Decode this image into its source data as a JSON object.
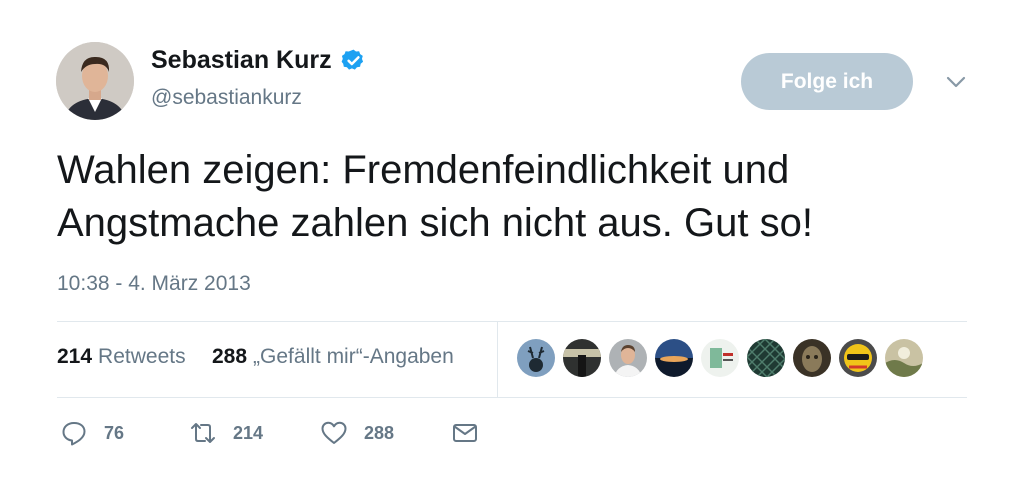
{
  "author": {
    "display_name": "Sebastian Kurz",
    "handle": "@sebastiankurz",
    "verified": true
  },
  "follow_button": {
    "label": "Folge ich"
  },
  "tweet": {
    "text": "Wahlen zeigen: Fremdenfeindlichkeit und Angstmache zahlen sich nicht aus. Gut so!",
    "timestamp": "10:38 - 4. März 2013"
  },
  "stats": {
    "retweets_count": "214",
    "retweets_label": "Retweets",
    "likes_count": "288",
    "likes_label": "„Gefällt mir“-Angaben"
  },
  "liker_avatars": [
    "deer-photo",
    "person-photo",
    "man-portrait",
    "sunset-photo",
    "logo-image",
    "net-pattern",
    "statue-photo",
    "helmet-photo",
    "pattern-photo"
  ],
  "actions": {
    "reply_count": "76",
    "retweet_count": "214",
    "like_count": "288"
  },
  "colors": {
    "verified": "#1da1f2",
    "follow_bg": "#b9cad6",
    "secondary_text": "#657786"
  }
}
